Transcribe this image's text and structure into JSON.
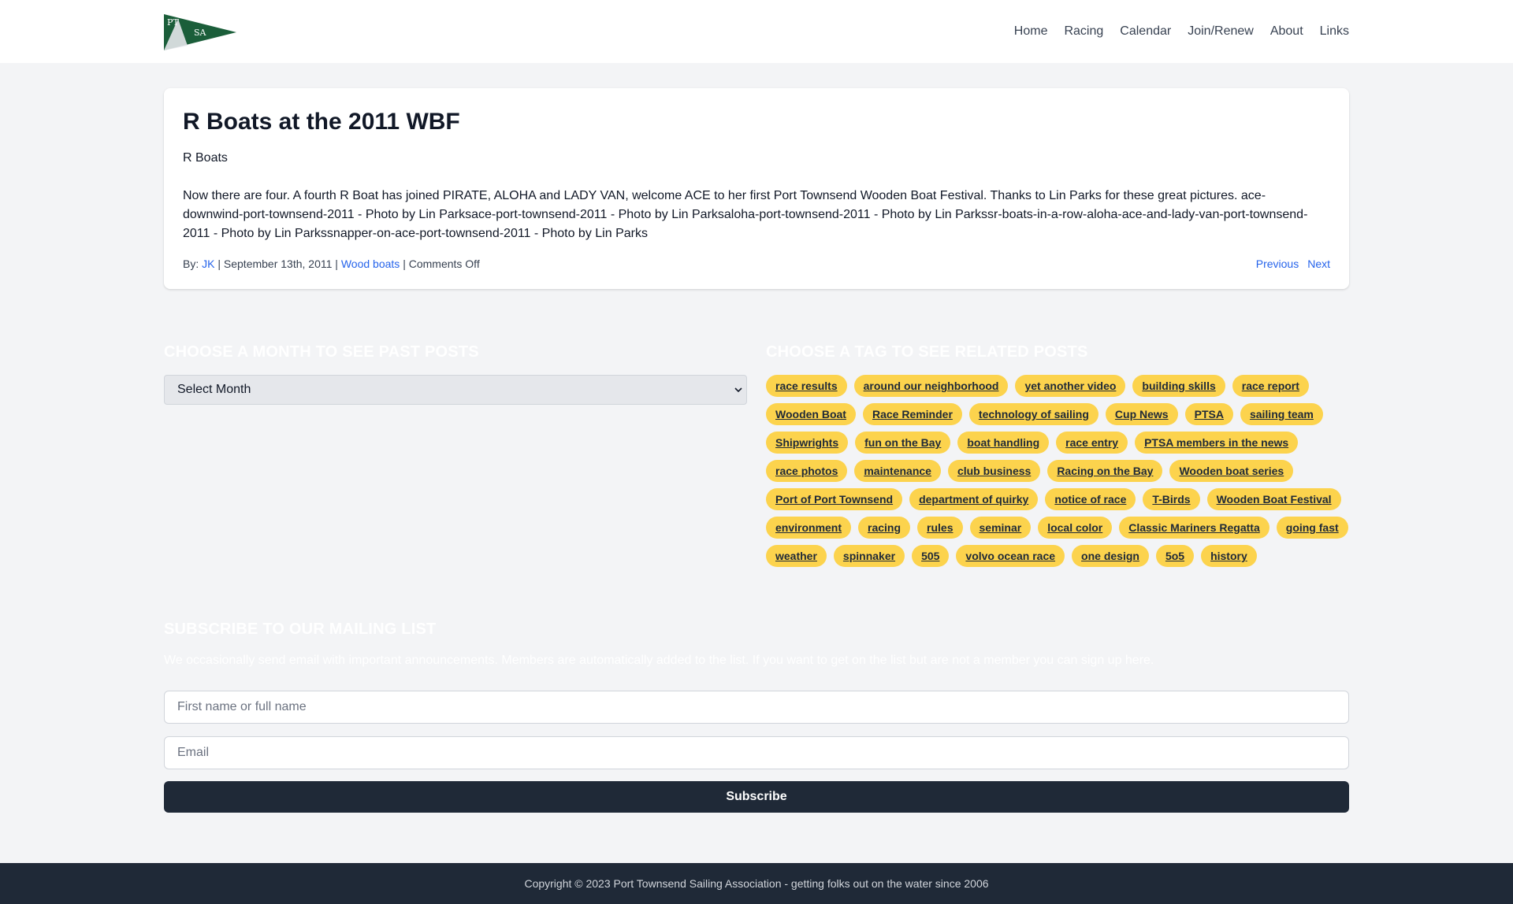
{
  "header": {
    "logo_text_top": "PT",
    "logo_text_right": "SA",
    "nav": [
      "Home",
      "Racing",
      "Calendar",
      "Join/Renew",
      "About",
      "Links"
    ]
  },
  "post": {
    "title": "R Boats at the 2011 WBF",
    "category": "R Boats",
    "body": "Now there are four. A fourth R Boat has joined PIRATE, ALOHA and LADY VAN, welcome ACE to her first Port Townsend Wooden Boat Festival. Thanks to Lin Parks for these great pictures. ace-downwind-port-townsend-2011 - Photo by Lin Parksace-port-townsend-2011 - Photo by Lin Parksaloha-port-townsend-2011 - Photo by Lin Parkssr-boats-in-a-row-aloha-ace-and-lady-van-port-townsend-2011 - Photo by Lin Parkssnapper-on-ace-port-townsend-2011 - Photo by Lin Parks",
    "meta_by": "By:",
    "author": "JK",
    "date": "September 13th, 2011",
    "category_link": "Wood boats",
    "comments": "Comments Off",
    "sep": "|",
    "previous": "Previous",
    "next": "Next"
  },
  "archive": {
    "heading": "CHOOSE A MONTH TO SEE PAST POSTS",
    "select_value": "Select Month"
  },
  "tag_section": {
    "heading": "CHOOSE A TAG TO SEE RELATED POSTS",
    "tags": [
      "race results",
      "around our neighborhood",
      "yet another video",
      "building skills",
      "race report",
      "Wooden Boat",
      "Race Reminder",
      "technology of sailing",
      "Cup News",
      "PTSA",
      "sailing team",
      "Shipwrights",
      "fun on the Bay",
      "boat handling",
      "race entry",
      "PTSA members in the news",
      "race photos",
      "maintenance",
      "club business",
      "Racing on the Bay",
      "Wooden boat series",
      "Port of Port Townsend",
      "department of quirky",
      "notice of race",
      "T-Birds",
      "Wooden Boat Festival",
      "environment",
      "racing",
      "rules",
      "seminar",
      "local color",
      "Classic Mariners Regatta",
      "going fast",
      "weather",
      "spinnaker",
      "505",
      "volvo ocean race",
      "one design",
      "5o5",
      "history"
    ]
  },
  "subscribe": {
    "heading": "SUBSCRIBE TO OUR MAILING LIST",
    "description": "We occasionally send email with important announcements. Members are automatically added to the list. If you want to get on the list but are not a member you can sign up here.",
    "name_placeholder": "First name or full name",
    "email_placeholder": "Email",
    "button": "Subscribe"
  },
  "footer": {
    "text": "Copyright © 2023 Port Townsend Sailing Association - getting folks out on the water since 2006"
  },
  "colors": {
    "tag_bg": "#fcd34d",
    "link": "#2563eb",
    "dark": "#1f2937",
    "pennant_green": "#1b5e3a"
  }
}
